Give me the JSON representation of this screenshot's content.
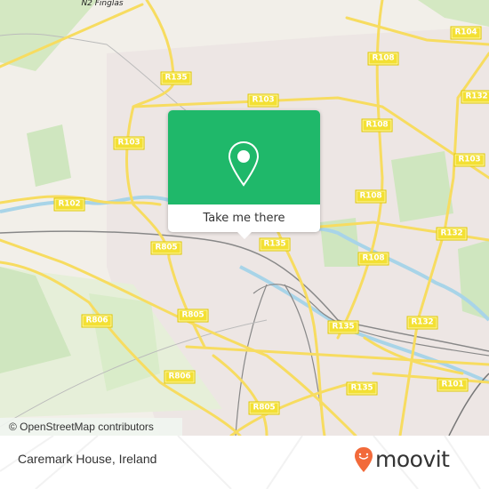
{
  "map": {
    "place_labels": [
      {
        "text": "N2 Finglas"
      }
    ],
    "road_labels": [
      {
        "id": "r135-north",
        "text": "R135"
      },
      {
        "id": "r103-top",
        "text": "R103"
      },
      {
        "id": "r108-a",
        "text": "R108"
      },
      {
        "id": "r104",
        "text": "R104"
      },
      {
        "id": "r108-b",
        "text": "R108"
      },
      {
        "id": "r132-a",
        "text": "R132"
      },
      {
        "id": "r103-left",
        "text": "R103"
      },
      {
        "id": "r103-right",
        "text": "R103"
      },
      {
        "id": "r102",
        "text": "R102"
      },
      {
        "id": "r108-c",
        "text": "R108"
      },
      {
        "id": "r805-a",
        "text": "R805"
      },
      {
        "id": "r135-mid",
        "text": "R135"
      },
      {
        "id": "r132-b",
        "text": "R132"
      },
      {
        "id": "r108-d",
        "text": "R108"
      },
      {
        "id": "r806-a",
        "text": "R806"
      },
      {
        "id": "r805-b",
        "text": "R805"
      },
      {
        "id": "r135-c",
        "text": "R135"
      },
      {
        "id": "r132-c",
        "text": "R132"
      },
      {
        "id": "r806-b",
        "text": "R806"
      },
      {
        "id": "r135-d",
        "text": "R135"
      },
      {
        "id": "r101",
        "text": "R101"
      },
      {
        "id": "r805-c",
        "text": "R805"
      }
    ],
    "attribution": "© OpenStreetMap contributors"
  },
  "popup": {
    "icon": "location-pin-icon",
    "button_label": "Take me there",
    "color": "#1fb86a"
  },
  "footer": {
    "place_name": "Caremark House, Ireland",
    "brand": "moovit",
    "brand_color": "#f26a3a"
  }
}
